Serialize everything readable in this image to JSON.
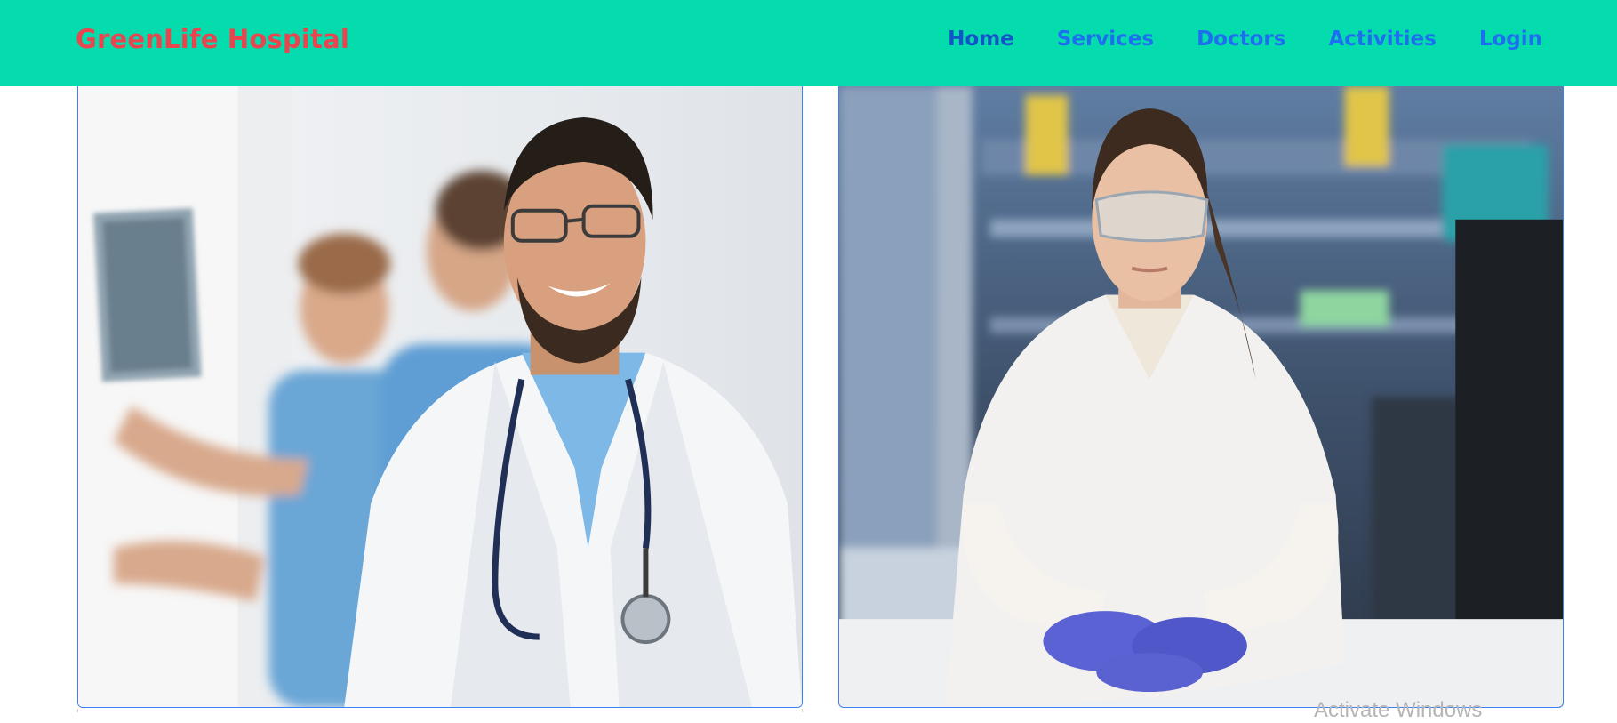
{
  "brand": {
    "name": "GreenLife Hospital"
  },
  "nav": {
    "items": [
      {
        "label": "Home"
      },
      {
        "label": "Services"
      },
      {
        "label": "Doctors"
      },
      {
        "label": "Activities"
      },
      {
        "label": "Login"
      }
    ]
  },
  "colors": {
    "navbar_bg": "#04dcae",
    "brand_text": "#e8454f",
    "nav_link": "#1e6ff0",
    "card_border": "#3b82f6"
  },
  "cards": [
    {
      "image": "smiling-male-doctor-with-stethoscope-photo"
    },
    {
      "image": "female-scientist-in-lab-coat-photo"
    }
  ],
  "watermark": {
    "text": "Activate Windows"
  }
}
